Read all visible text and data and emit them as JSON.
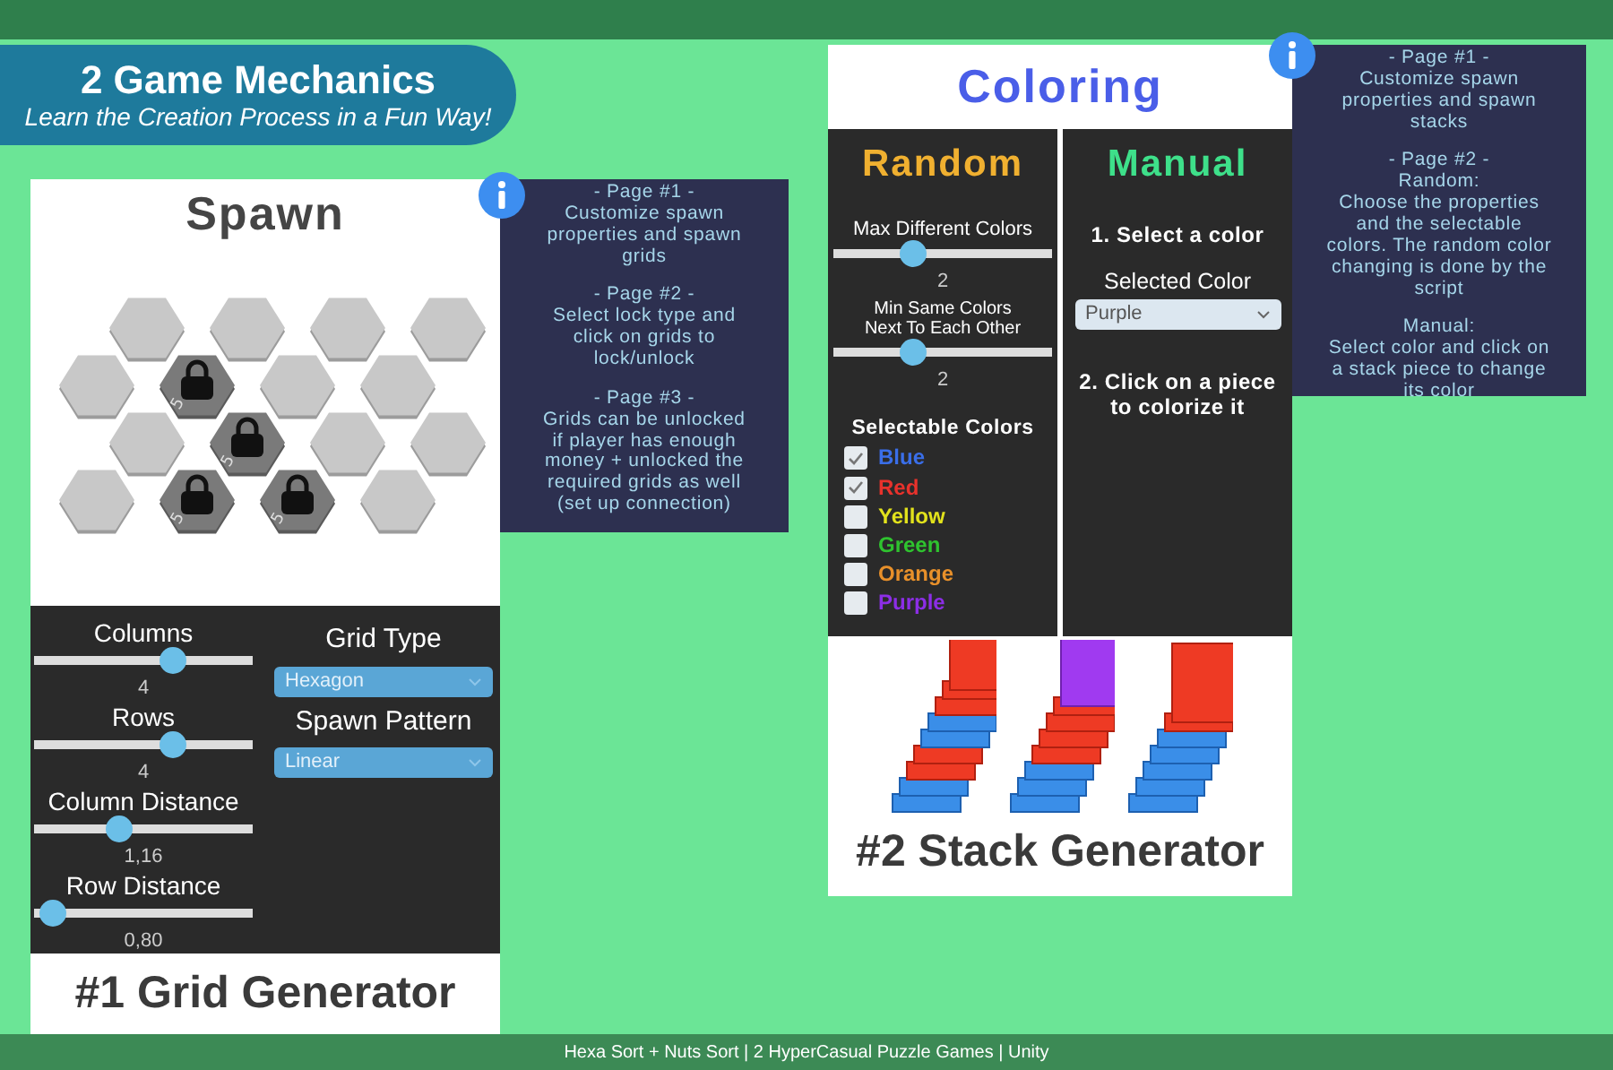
{
  "banner": {
    "title": "2 Game Mechanics",
    "subtitle": "Learn the Creation Process in a Fun Way!"
  },
  "grid_generator": {
    "title": "Spawn",
    "grid": [
      [
        {
          "locked": false
        },
        {
          "locked": false
        },
        {
          "locked": false
        },
        {
          "locked": false
        }
      ],
      [
        {
          "locked": false
        },
        {
          "locked": true,
          "label": "5"
        },
        {
          "locked": false
        },
        {
          "locked": false
        }
      ],
      [
        {
          "locked": false
        },
        {
          "locked": true,
          "label": "5"
        },
        {
          "locked": false
        },
        {
          "locked": false
        }
      ],
      [
        {
          "locked": false
        },
        {
          "locked": true,
          "label": "5"
        },
        {
          "locked": true,
          "label": "5"
        },
        {
          "locked": false
        }
      ]
    ],
    "sliders": [
      {
        "label": "Columns",
        "level": 0.65,
        "value": "4"
      },
      {
        "label": "Rows",
        "level": 0.65,
        "value": "4"
      },
      {
        "label": "Column Distance",
        "level": 0.37,
        "value": "1,16"
      },
      {
        "label": "Row Distance",
        "level": 0.03,
        "value": "0,80"
      }
    ],
    "dropdowns": [
      {
        "label": "Grid Type",
        "value": "Hexagon",
        "disabled": true
      },
      {
        "label": "Spawn Pattern",
        "value": "Linear",
        "disabled": true
      }
    ],
    "caption": "#1 Grid Generator",
    "info": [
      [
        "- Page #1 -",
        "Customize spawn",
        "properties and spawn",
        "grids"
      ],
      [
        "- Page #2 -",
        "Select lock type and",
        "click on grids to",
        "lock/unlock"
      ],
      [
        "- Page #3 -",
        "Grids can be unlocked",
        "if player has enough",
        "money + unlocked the",
        "required grids as well",
        "(set up connection)"
      ]
    ]
  },
  "stack_generator": {
    "title": "Coloring",
    "random": {
      "heading": "Random",
      "sliders": [
        {
          "label": "Max Different Colors",
          "level": 0.35,
          "value": "2"
        },
        {
          "label": "Min Same Colors\nNext To Each Other",
          "level": 0.35,
          "value": "2"
        }
      ],
      "colors_heading": "Selectable Colors",
      "colors": [
        {
          "label": "Blue",
          "checked": true,
          "color": "#3a6ee8"
        },
        {
          "label": "Red",
          "checked": true,
          "color": "#e8322c"
        },
        {
          "label": "Yellow",
          "checked": false,
          "color": "#e2e21c"
        },
        {
          "label": "Green",
          "checked": false,
          "color": "#2fc32f"
        },
        {
          "label": "Orange",
          "checked": false,
          "color": "#e8902a"
        },
        {
          "label": "Purple",
          "checked": false,
          "color": "#8c2ee6"
        }
      ]
    },
    "manual": {
      "heading": "Manual",
      "step_1": "1. Select a color",
      "dropdown_label": "Selected Color",
      "dropdown_value": "Purple",
      "step_2": "2. Click on a piece\nto colorize it"
    },
    "caption": "#2 Stack Generator",
    "info": [
      [
        "- Page #1 -",
        "Customize spawn",
        "properties and spawn",
        "stacks"
      ],
      [
        "- Page #2 -",
        "Random:",
        "Choose the properties",
        "and the selectable",
        "colors. The random color",
        "changing is done by the",
        "script"
      ],
      [
        "Manual:",
        "Select color and click on",
        "a stack piece to change",
        "its color"
      ]
    ]
  },
  "footer": "Hexa Sort + Nuts Sort | 2 HyperCasual Puzzle Games | Unity"
}
